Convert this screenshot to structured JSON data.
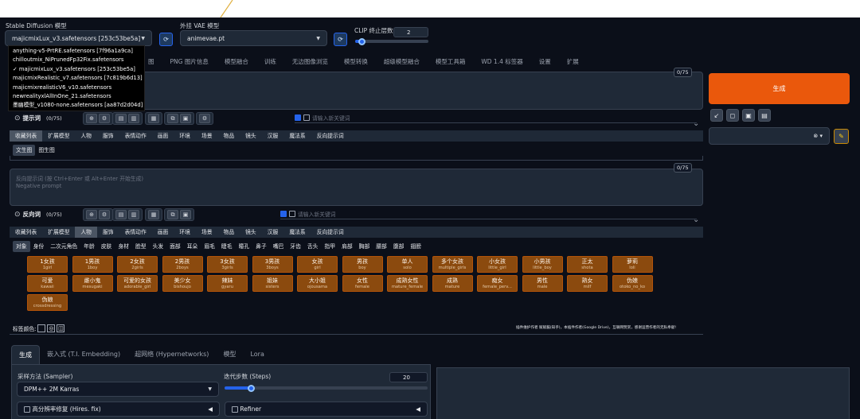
{
  "model": {
    "sd_label": "Stable Diffusion 模型",
    "sd_value": "majicmixLux_v3.safetensors [253c53be5a]",
    "vae_label": "外挂 VAE 模型",
    "vae_value": "animevae.pt",
    "clip_label": "CLIP 终止层数",
    "clip_value": "2",
    "clip_fraction": 0.09
  },
  "dropdown": {
    "options": [
      "anything-v5-PrtRE.safetensors [7f96a1a9ca]",
      "chilloutmix_NiPrunedFp32Fix.safetensors",
      "majicmixLux_v3.safetensors [253c53be5a]",
      "majicmixRealistic_v7.safetensors [7c819b6d13]",
      "majicmixrealisticV6_v10.safetensors",
      "newrealityxlAllInOne_21.safetensors",
      "墨幽模型_v1080-none.safetensors [aa87d2d04d]"
    ],
    "checkmark": "✓"
  },
  "main_tabs": [
    "图",
    "PNG 图片信息",
    "模型融合",
    "训练",
    "无边图像浏览",
    "模型转换",
    "超级模型融合",
    "模型工具箱",
    "WD 1.4 标签器",
    "设置",
    "扩展"
  ],
  "prompt": {
    "counter": "0/75",
    "label": "提示词",
    "label_count": "(0/75)",
    "new_keyword_placeholder": "请输入新关键词",
    "category_tabs": [
      "收藏列表",
      "扩展模型",
      "人物",
      "服饰",
      "表情动作",
      "画面",
      "环境",
      "场景",
      "物品",
      "镜头",
      "汉服",
      "魔法系",
      "反向提示词"
    ],
    "sub_tabs": [
      "文生图",
      "图生图"
    ]
  },
  "negative": {
    "counter": "0/75",
    "placeholder_line1": "反向提示词 (按 Ctrl+Enter 或 Alt+Enter 开始生成)",
    "placeholder_line2": "Negative prompt",
    "label": "反向词",
    "label_count": "(0/75)",
    "new_keyword_placeholder": "请输入新关键词",
    "category_tabs": [
      "收藏列表",
      "扩展模型",
      "人物",
      "服饰",
      "表情动作",
      "画面",
      "环境",
      "场景",
      "物品",
      "镜头",
      "汉服",
      "魔法系",
      "反向提示词"
    ],
    "sub_tabs": [
      "对象",
      "身份",
      "二次元角色",
      "年龄",
      "皮肤",
      "身材",
      "脸型",
      "头发",
      "面部",
      "耳朵",
      "眉毛",
      "睫毛",
      "瞳孔",
      "鼻子",
      "嘴巴",
      "牙齿",
      "舌头",
      "指甲",
      "肩部",
      "胸部",
      "腰部",
      "腹部",
      "翅膀"
    ]
  },
  "tags": [
    {
      "zh": "1女孩",
      "en": "1girl"
    },
    {
      "zh": "1男孩",
      "en": "1boy"
    },
    {
      "zh": "2女孩",
      "en": "2girls"
    },
    {
      "zh": "2男孩",
      "en": "2boys"
    },
    {
      "zh": "3女孩",
      "en": "3girls"
    },
    {
      "zh": "3男孩",
      "en": "3boys"
    },
    {
      "zh": "女孩",
      "en": "girl"
    },
    {
      "zh": "男孩",
      "en": "boy"
    },
    {
      "zh": "单人",
      "en": "solo"
    },
    {
      "zh": "多个女孩",
      "en": "multiple_girls"
    },
    {
      "zh": "小女孩",
      "en": "little_girl"
    },
    {
      "zh": "小男孩",
      "en": "little_boy"
    },
    {
      "zh": "正太",
      "en": "shota"
    },
    {
      "zh": "萝莉",
      "en": "loli"
    },
    {
      "zh": "可爱",
      "en": "kawaii"
    },
    {
      "zh": "雌小鬼",
      "en": "mesugaki"
    },
    {
      "zh": "可爱的女孩",
      "en": "adorable_girl"
    },
    {
      "zh": "美少女",
      "en": "bishoujo"
    },
    {
      "zh": "辣妹",
      "en": "gyaru"
    },
    {
      "zh": "姐妹",
      "en": "sisters"
    },
    {
      "zh": "大小姐",
      "en": "ojousama"
    },
    {
      "zh": "女性",
      "en": "female"
    },
    {
      "zh": "成熟女性",
      "en": "mature_female"
    },
    {
      "zh": "成熟",
      "en": "mature"
    },
    {
      "zh": "痴女",
      "en": "female_perv..."
    },
    {
      "zh": "男性",
      "en": "male"
    },
    {
      "zh": "熟女",
      "en": "milf"
    },
    {
      "zh": "伪娘",
      "en": "otoko_no_ko"
    },
    {
      "zh": "伪娘",
      "en": "crossdressing"
    }
  ],
  "tag_color_label": "标签颜色:",
  "footer_note": "插件维护作者 赋赋酱(知乎)，本插件作者(Google Drive)，互联网赞赏，感谢运营作者的无私奉献!",
  "generate_label": "生成",
  "bottom": {
    "tabs": [
      "生成",
      "嵌入式 (T.I. Embedding)",
      "超网络 (Hypernetworks)",
      "模型",
      "Lora"
    ],
    "sampler_label": "采样方法 (Sampler)",
    "sampler_value": "DPM++ 2M Karras",
    "steps_label": "迭代步数 (Steps)",
    "steps_value": "20",
    "steps_fraction": 0.13,
    "hires_label": "高分辨率修复 (Hires. fix)",
    "refiner_label": "Refiner"
  },
  "colors": {
    "accent": "#2563eb",
    "generate": "#ea580c",
    "tag": "#8b4a0e",
    "background": "#0b0f19"
  }
}
